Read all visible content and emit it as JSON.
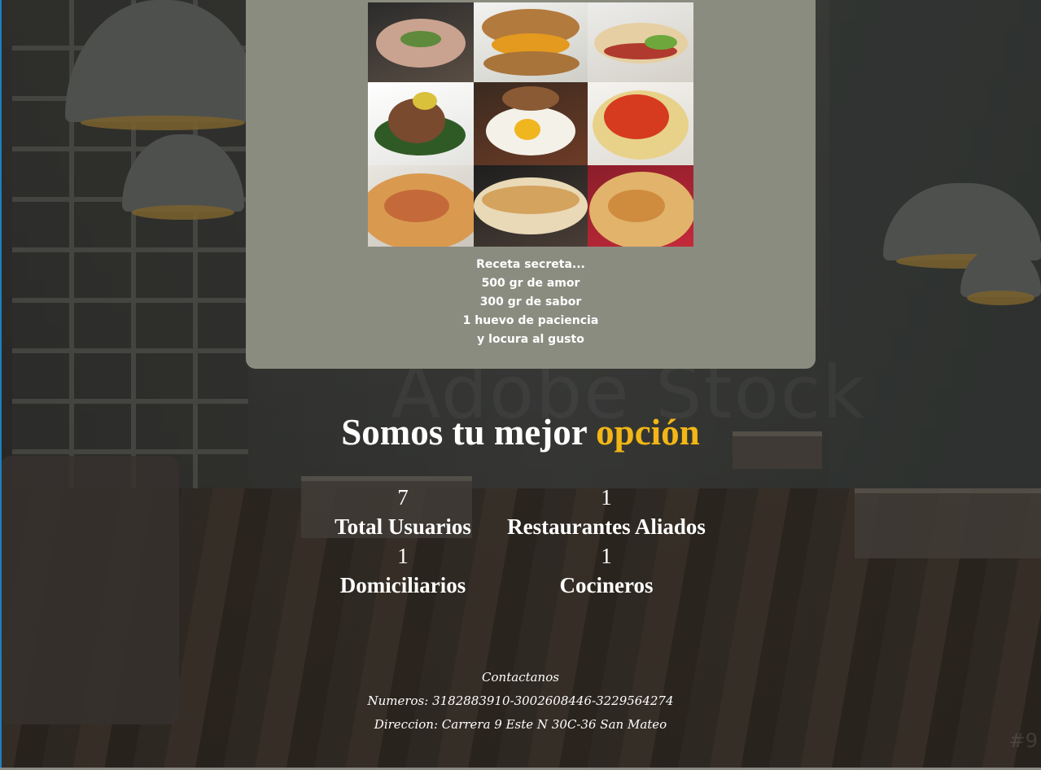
{
  "recipe_lines": [
    "Receta secreta...",
    "500 gr de amor",
    "300 gr de sabor",
    "1 huevo de paciencia",
    "y locura al gusto"
  ],
  "headline": {
    "main": "Somos tu mejor",
    "accent": "opción"
  },
  "stats": [
    {
      "value": "7",
      "label": "Total Usuarios"
    },
    {
      "value": "1",
      "label": "Restaurantes Aliados"
    },
    {
      "value": "1",
      "label": "Domiciliarios"
    },
    {
      "value": "1",
      "label": "Cocineros"
    }
  ],
  "contact": {
    "title": "Contactanos",
    "numbers": "Numeros: 3182883910-3002608446-3229564274",
    "address": "Direccion: Carrera 9 Este N 30C-36 San Mateo"
  },
  "background": {
    "watermark": "Adobe Stock",
    "corner_mark": "#9"
  },
  "colors": {
    "card": "#8b8c80",
    "accent": "#f2b616",
    "text": "#ffffff"
  }
}
